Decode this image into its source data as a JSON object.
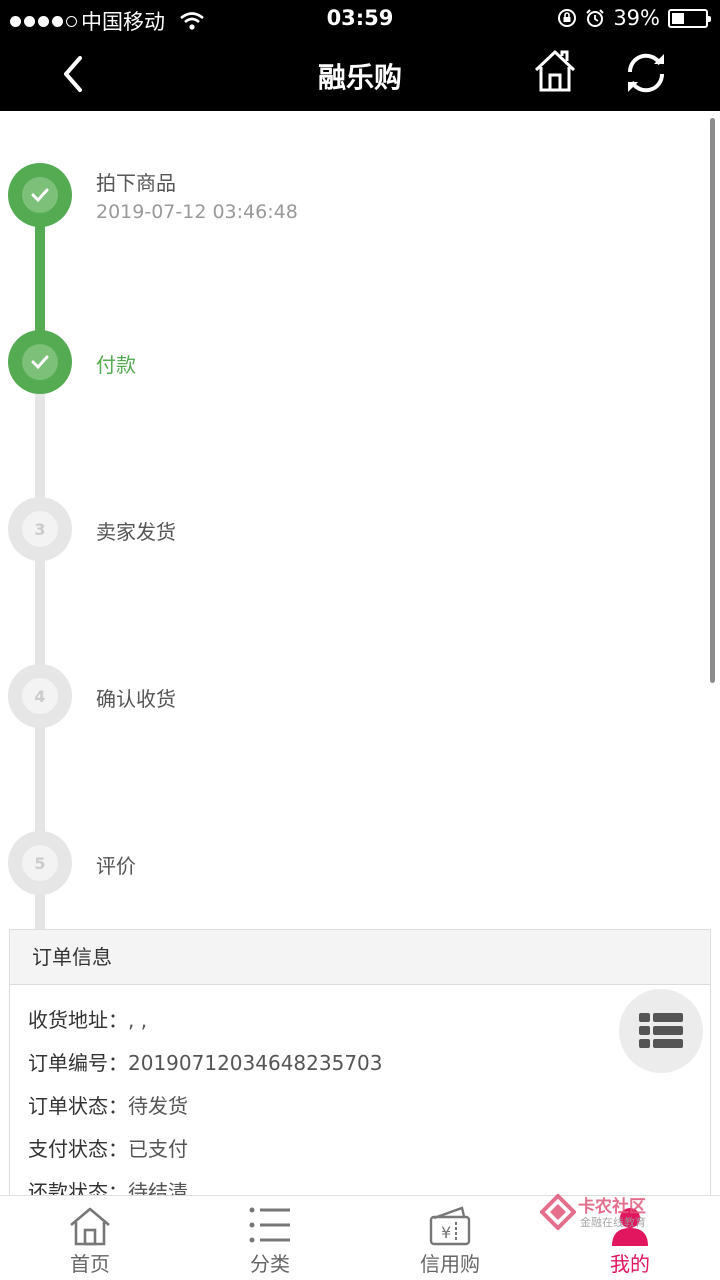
{
  "status_bar": {
    "carrier": "中国移动",
    "time": "03:59",
    "battery": "39%",
    "battery_level": 0.39
  },
  "nav": {
    "title": "融乐购",
    "back_icon": "back-arrow-icon",
    "home_icon": "home-icon",
    "refresh_icon": "refresh-icon"
  },
  "timeline": {
    "steps": [
      {
        "number": "1",
        "label": "拍下商品",
        "time": "2019-07-12 03:46:48",
        "status": "done"
      },
      {
        "number": "2",
        "label": "付款",
        "time": "",
        "status": "current"
      },
      {
        "number": "3",
        "label": "卖家发货",
        "time": "",
        "status": "pending"
      },
      {
        "number": "4",
        "label": "确认收货",
        "time": "",
        "status": "pending"
      },
      {
        "number": "5",
        "label": "评价",
        "time": "",
        "status": "pending"
      }
    ],
    "colors": {
      "done": "#55ab52",
      "pending": "#e6e6e6"
    }
  },
  "order": {
    "header": "订单信息",
    "rows": [
      {
        "key": "收货地址：",
        "value": ", ,"
      },
      {
        "key": "订单编号：",
        "value": "20190712034648235703"
      },
      {
        "key": "订单状态：",
        "value": "待发货"
      },
      {
        "key": "支付状态：",
        "value": "已支付"
      },
      {
        "key": "还款状态：",
        "value": "待结清"
      }
    ]
  },
  "float_button": {
    "icon": "list-menu-icon"
  },
  "tabs": [
    {
      "label": "首页",
      "icon": "home-outline-icon",
      "active": false
    },
    {
      "label": "分类",
      "icon": "category-list-icon",
      "active": false
    },
    {
      "label": "信用购",
      "icon": "wallet-icon",
      "active": false
    },
    {
      "label": "我的",
      "icon": "user-icon",
      "active": true
    }
  ],
  "watermark": {
    "title": "卡农社区",
    "subtitle": "金融在线教育"
  },
  "accent_color": "#e2155f"
}
